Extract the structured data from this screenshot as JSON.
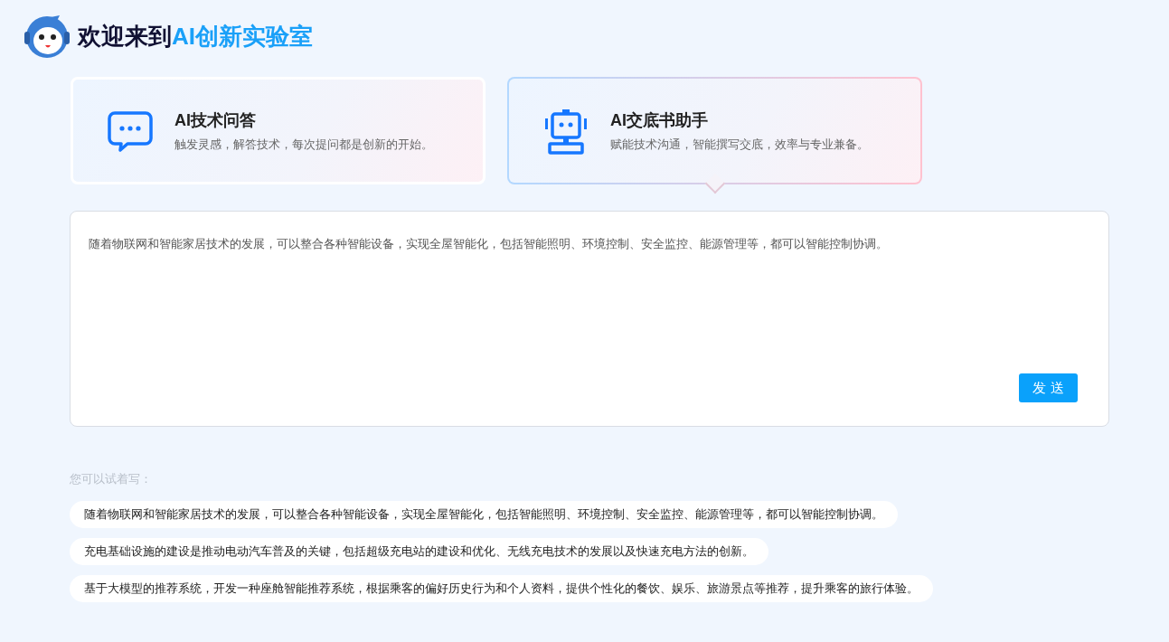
{
  "header": {
    "title": "欢迎来到",
    "title_highlight": "AI创新实验室"
  },
  "modes": [
    {
      "kind": "chat",
      "title": "AI技术问答",
      "description": "触发灵感，解答技术，每次提问都是创新的开始。",
      "selected": false
    },
    {
      "kind": "robot",
      "title": "AI交底书助手",
      "description": "赋能技术沟通，智能撰写交底，效率与专业兼备。",
      "selected": true
    }
  ],
  "input": {
    "value": "随着物联网和智能家居技术的发展，可以整合各种智能设备，实现全屋智能化，包括智能照明、环境控制、安全监控、能源管理等，都可以智能控制协调。",
    "send_button": "发 送"
  },
  "suggestions": {
    "label": "您可以试着写：",
    "items": [
      "随着物联网和智能家居技术的发展，可以整合各种智能设备，实现全屋智能化，包括智能照明、环境控制、安全监控、能源管理等，都可以智能控制协调。",
      "充电基础设施的建设是推动电动汽车普及的关键，包括超级充电站的建设和优化、无线充电技术的发展以及快速充电方法的创新。",
      "基于大模型的推荐系统，开发一种座舱智能推荐系统，根据乘客的偏好历史行为和个人资料，提供个性化的餐饮、娱乐、旅游景点等推荐，提升乘客的旅行体验。"
    ]
  }
}
